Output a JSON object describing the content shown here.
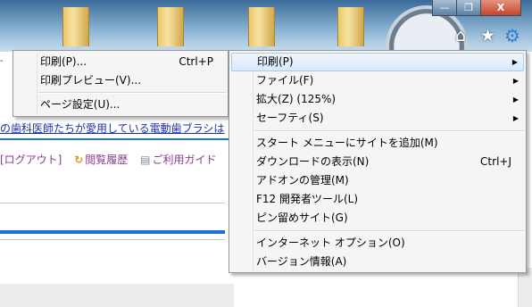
{
  "window": {
    "minimize_label": "—",
    "maximize_label": "❐",
    "close_label": "X",
    "icons": [
      "home-icon",
      "favorites-star-icon",
      "tools-gear-icon"
    ]
  },
  "page": {
    "headline": "の歯科医師たちが愛用している電動歯ブラシは",
    "nav": {
      "logout": "[ログアウト]",
      "history": "閲覧履歴",
      "guide": "ご利用ガイド"
    },
    "address_fragment": "-"
  },
  "print_submenu": {
    "items": [
      {
        "label": "印刷(P)...",
        "shortcut": "Ctrl+P"
      },
      {
        "label": "印刷プレビュー(V)...",
        "shortcut": ""
      },
      {
        "label": "ページ設定(U)...",
        "shortcut": ""
      }
    ]
  },
  "tools_menu": {
    "group1": [
      {
        "label": "印刷(P)",
        "arrow": "▶"
      },
      {
        "label": "ファイル(F)",
        "arrow": "▶"
      },
      {
        "label": "拡大(Z) (125%)",
        "arrow": "▶"
      },
      {
        "label": "セーフティ(S)",
        "arrow": "▶"
      }
    ],
    "group2": [
      {
        "label": "スタート メニューにサイトを追加(M)",
        "shortcut": ""
      },
      {
        "label": "ダウンロードの表示(N)",
        "shortcut": "Ctrl+J"
      },
      {
        "label": "アドオンの管理(M)",
        "shortcut": ""
      },
      {
        "label": "F12 開発者ツール(L)",
        "shortcut": ""
      },
      {
        "label": "ピン留めサイト(G)",
        "shortcut": ""
      }
    ],
    "group3": [
      {
        "label": "インターネット オプション(O)",
        "shortcut": ""
      },
      {
        "label": "バージョン情報(A)",
        "shortcut": ""
      }
    ]
  },
  "colors": {
    "link": "#1a2fb0",
    "accent_blue": "#1b73d3",
    "gear": "#2e7fd1",
    "menu_bg": "#f5f5f5",
    "highlight_border": "#a9c9ee"
  }
}
